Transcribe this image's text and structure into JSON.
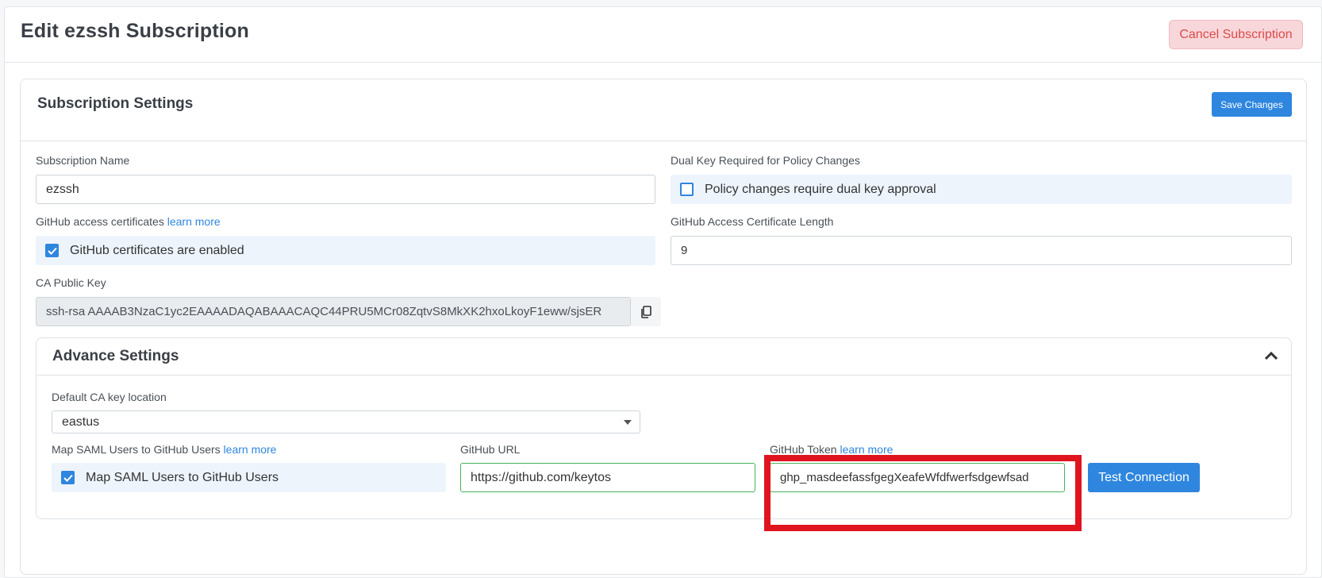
{
  "page": {
    "title": "Edit ezssh Subscription",
    "cancel_label": "Cancel Subscription"
  },
  "settings": {
    "title": "Subscription Settings",
    "save_label": "Save Changes",
    "subscription_name": {
      "label": "Subscription Name",
      "value": "ezssh"
    },
    "dual_key": {
      "label": "Dual Key Required for Policy Changes",
      "checkbox_label": "Policy changes require dual key approval",
      "checked": false
    },
    "github_certs": {
      "label": "GitHub access certificates",
      "link": "learn more",
      "checkbox_label": "GitHub certificates are enabled",
      "checked": true
    },
    "cert_length": {
      "label": "GitHub Access Certificate Length",
      "value": "9"
    },
    "ca_public_key": {
      "label": "CA Public Key",
      "value": "ssh-rsa AAAAB3NzaC1yc2EAAAADAQABAAACAQC44PRU5MCr08ZqtvS8MkXK2hxoLkoyF1eww/sjsER"
    }
  },
  "advance": {
    "title": "Advance Settings",
    "ca_location": {
      "label": "Default CA key location",
      "value": "eastus"
    },
    "saml_map": {
      "label": "Map SAML Users to GitHub Users",
      "link": "learn more",
      "checkbox_label": "Map SAML Users to GitHub Users",
      "checked": true
    },
    "github_url": {
      "label": "GitHub URL",
      "value": "https://github.com/keytos"
    },
    "github_token": {
      "label": "GitHub Token",
      "link": "learn more",
      "value": "ghp_masdeefassfgegXeafeWfdfwerfsdgewfsad"
    },
    "test_label": "Test Connection"
  },
  "colors": {
    "accent": "#2e86de",
    "danger": "#dc4a4a",
    "valid_border": "#46b35a",
    "highlight": "#e0141f"
  }
}
